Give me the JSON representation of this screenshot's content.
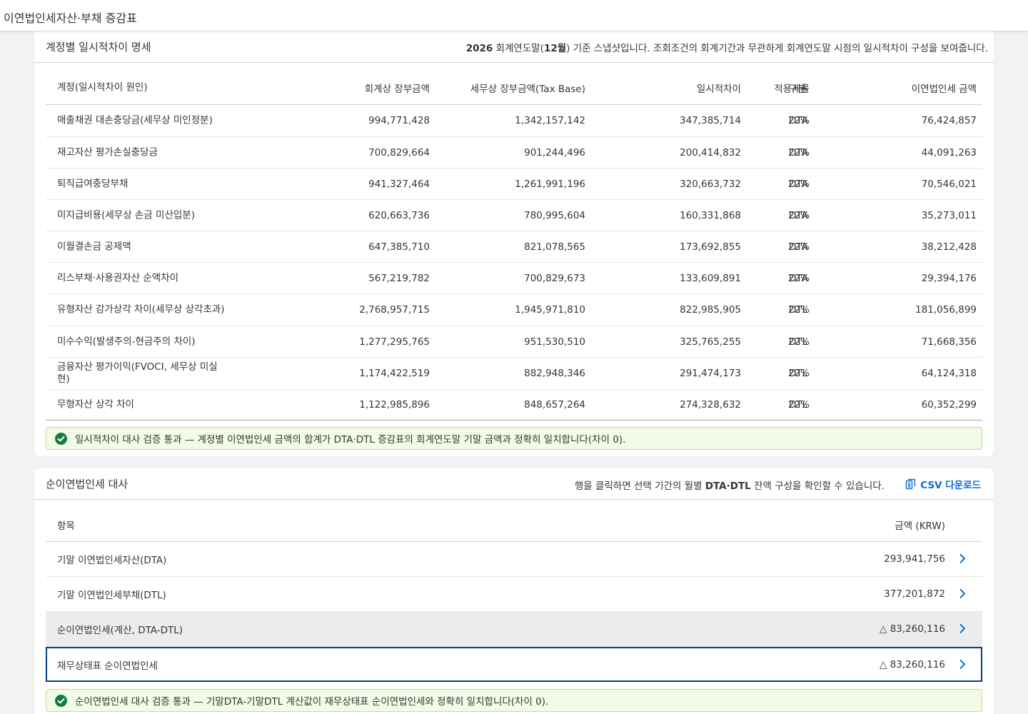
{
  "app": {
    "title": "이연법인세자산·부채 증감표"
  },
  "section1": {
    "title": "계정별 일시적차이 명세",
    "note": {
      "year": "2026",
      "part1": " 회계연도말(",
      "month": "12월",
      "part2": ") 기준 스냅샷입니다. 조회조건의 회계기간과 무관하게 회계연도말 시점의 일시적차이 구성을 보여줍니다."
    },
    "columns": {
      "account": "계정(일시적차이 원인)",
      "book": "회계상 장부금액",
      "tax": "세무상 장부금액(Tax Base)",
      "diff": "일시적차이",
      "rate": "적용세율",
      "kind": "구분",
      "amount": "이연법인세 금액"
    },
    "rows": [
      {
        "account": "매출채권 대손충당금(세무상 미인정분)",
        "book": "994,771,428",
        "tax": "1,342,157,142",
        "diff": "347,385,714",
        "rate": "22%",
        "kind": "DTA",
        "amount": "76,424,857"
      },
      {
        "account": "재고자산 평가손실충당금",
        "book": "700,829,664",
        "tax": "901,244,496",
        "diff": "200,414,832",
        "rate": "22%",
        "kind": "DTA",
        "amount": "44,091,263"
      },
      {
        "account": "퇴직급여충당부채",
        "book": "941,327,464",
        "tax": "1,261,991,196",
        "diff": "320,663,732",
        "rate": "22%",
        "kind": "DTA",
        "amount": "70,546,021"
      },
      {
        "account": "미지급비용(세무상 손금 미산입분)",
        "book": "620,663,736",
        "tax": "780,995,604",
        "diff": "160,331,868",
        "rate": "22%",
        "kind": "DTA",
        "amount": "35,273,011"
      },
      {
        "account": "이월결손금 공제액",
        "book": "647,385,710",
        "tax": "821,078,565",
        "diff": "173,692,855",
        "rate": "22%",
        "kind": "DTA",
        "amount": "38,212,428"
      },
      {
        "account": "리스부채·사용권자산 순액차이",
        "book": "567,219,782",
        "tax": "700,829,673",
        "diff": "133,609,891",
        "rate": "22%",
        "kind": "DTA",
        "amount": "29,394,176"
      },
      {
        "account": "유형자산 감가상각 차이(세무상 상각초과)",
        "book": "2,768,957,715",
        "tax": "1,945,971,810",
        "diff": "822,985,905",
        "rate": "22%",
        "kind": "DTL",
        "amount": "181,056,899"
      },
      {
        "account": "미수수익(발생주의-현금주의 차이)",
        "book": "1,277,295,765",
        "tax": "951,530,510",
        "diff": "325,765,255",
        "rate": "22%",
        "kind": "DTL",
        "amount": "71,668,356"
      },
      {
        "account": "금융자산 평가이익(FVOCI, 세무상 미실현)",
        "book": "1,174,422,519",
        "tax": "882,948,346",
        "diff": "291,474,173",
        "rate": "22%",
        "kind": "DTL",
        "amount": "64,124,318"
      },
      {
        "account": "무형자산 상각 차이",
        "book": "1,122,985,896",
        "tax": "848,657,264",
        "diff": "274,328,632",
        "rate": "22%",
        "kind": "DTL",
        "amount": "60,352,299"
      }
    ],
    "banner": "일시적차이 대사 검증 통과 — 계정별 이연법인세 금액의 합계가 DTA·DTL 증감표의 회계연도말 기말 금액과 정확히 일치합니다(차이 0)."
  },
  "section2": {
    "title": "순이연법인세 대사",
    "note": {
      "part1": "행을 클릭하면 선택 기간의 월별 ",
      "bold": "DTA·DTL",
      "part2": " 잔액 구성을 확인할 수 있습니다."
    },
    "csv_label": "CSV 다운로드",
    "columns": {
      "item": "항목",
      "amount": "금액 (KRW)"
    },
    "rows": [
      {
        "item": "기말 이연법인세자산(DTA)",
        "amount": "293,941,756"
      },
      {
        "item": "기말 이연법인세부채(DTL)",
        "amount": "377,201,872"
      },
      {
        "item": "순이연법인세(계산, DTA-DTL)",
        "amount": "△ 83,260,116"
      },
      {
        "item": "재무상태표 순이연법인세",
        "amount": "△ 83,260,116"
      }
    ],
    "banner": "순이연법인세 대사 검증 통과 — 기말DTA-기말DTL 계산값이 재무상태표 순이연법인세와 정확히 일치합니다(차이 0)."
  },
  "colors": {
    "accent": "#0a6ed1",
    "success": "#107e3e",
    "selected_border": "#0a3d8f"
  },
  "icons": {
    "check": "check-circle-icon",
    "csv": "spreadsheet-export-icon",
    "chevron": "chevron-right-icon"
  }
}
